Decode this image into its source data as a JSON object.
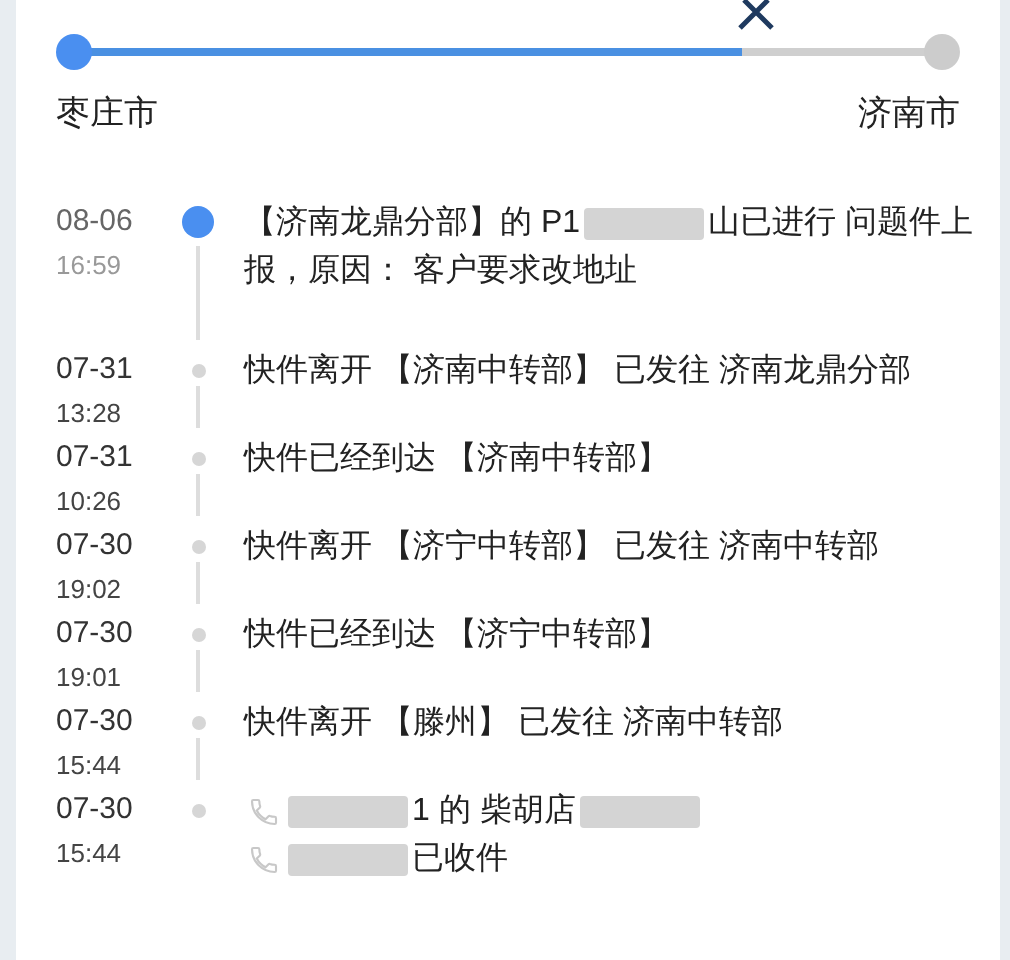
{
  "route": {
    "origin": "枣庄市",
    "destination": "济南市",
    "level": 0.77
  },
  "events": [
    {
      "date": "08-06",
      "time": "16:59",
      "current": true,
      "lines": [
        [
          {
            "kind": "text",
            "text": "【济南龙鼎分部】的 P1"
          },
          {
            "kind": "redacted"
          },
          {
            "kind": "text",
            "text": "山已进行 问题件上"
          }
        ],
        [
          {
            "kind": "text",
            "text": "报，原因： 客户要求改地址"
          }
        ]
      ]
    },
    {
      "date": "07-31",
      "time": "13:28",
      "current": false,
      "lines": [
        [
          {
            "kind": "text",
            "text": "快件离开 【济南中转部】 已发往 济南龙鼎分部"
          }
        ]
      ]
    },
    {
      "date": "07-31",
      "time": "10:26",
      "current": false,
      "lines": [
        [
          {
            "kind": "text",
            "text": "快件已经到达 【济南中转部】"
          }
        ]
      ]
    },
    {
      "date": "07-30",
      "time": "19:02",
      "current": false,
      "lines": [
        [
          {
            "kind": "text",
            "text": "快件离开 【济宁中转部】 已发往 济南中转部"
          }
        ]
      ]
    },
    {
      "date": "07-30",
      "time": "19:01",
      "current": false,
      "lines": [
        [
          {
            "kind": "text",
            "text": "快件已经到达 【济宁中转部】"
          }
        ]
      ]
    },
    {
      "date": "07-30",
      "time": "15:44",
      "current": false,
      "lines": [
        [
          {
            "kind": "text",
            "text": "快件离开 【滕州】 已发往 济南中转部"
          }
        ]
      ]
    },
    {
      "date": "07-30",
      "time": "15:44",
      "current": false,
      "lines": [
        [
          {
            "kind": "phone"
          },
          {
            "kind": "redacted"
          },
          {
            "kind": "text",
            "text": "1 的 柴胡店"
          },
          {
            "kind": "redacted"
          }
        ],
        [
          {
            "kind": "phone"
          },
          {
            "kind": "redacted"
          },
          {
            "kind": "text",
            "text": "已收件"
          }
        ]
      ]
    }
  ]
}
